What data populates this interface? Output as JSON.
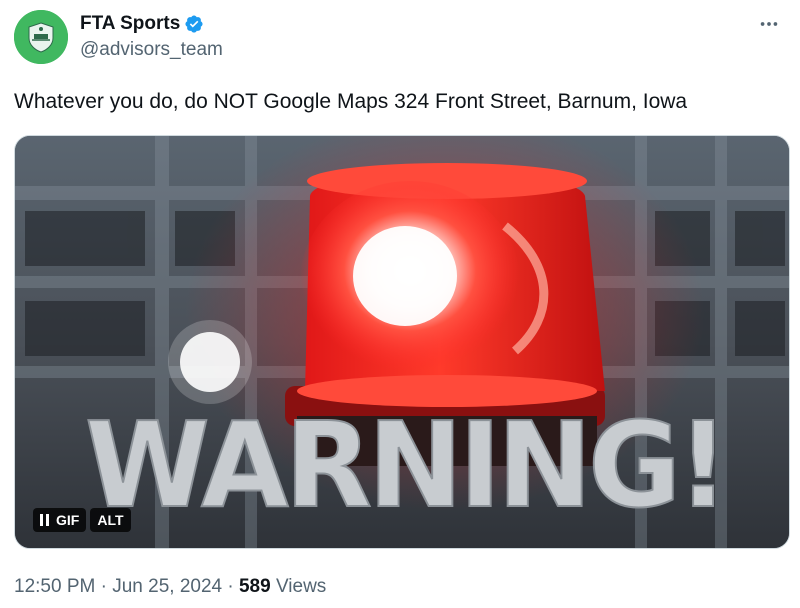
{
  "author": {
    "display_name": "FTA Sports",
    "handle": "@advisors_team",
    "verified": true,
    "avatar_color": "#40b860"
  },
  "tweet": {
    "text": "Whatever you do, do NOT Google Maps 324 Front Street, Barnum, Iowa"
  },
  "media": {
    "type": "gif",
    "overlay_text": "WARNING!",
    "controls": {
      "pause_icon": "pause-icon",
      "gif_label": "GIF",
      "alt_label": "ALT"
    },
    "colors": {
      "siren_red": "#ff2a2a",
      "background": "#3b4148"
    }
  },
  "meta": {
    "time": "12:50 PM",
    "separator": "·",
    "date": "Jun 25, 2024",
    "views_count": "589",
    "views_label": "Views"
  },
  "icons": {
    "more": "more-horizontal-icon",
    "verified": "verified-badge-icon"
  },
  "colors": {
    "primary_text": "#0f1419",
    "secondary_text": "#536471",
    "verified_blue": "#1d9bf0"
  }
}
